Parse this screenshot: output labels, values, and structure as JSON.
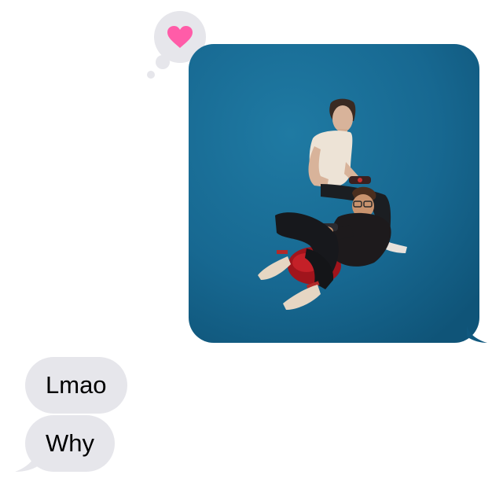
{
  "thread": {
    "reaction": {
      "icon": "heart-icon",
      "color": "#ff5ca8",
      "bubble_color": "#e6e6eb"
    },
    "outgoing_photo": {
      "icon": "photo-attachment"
    },
    "incoming_messages": [
      {
        "text": "Lmao"
      },
      {
        "text": "Why"
      }
    ],
    "colors": {
      "incoming_bubble": "#e6e6eb",
      "photo_background": "#1a6891",
      "text": "#000000"
    }
  }
}
